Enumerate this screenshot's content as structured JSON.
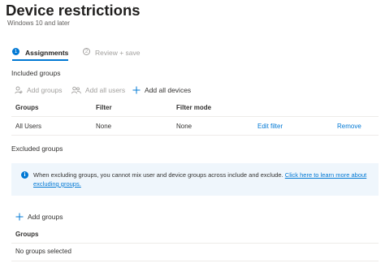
{
  "header": {
    "title": "Device restrictions",
    "more_label": "···",
    "subtitle": "Windows 10 and later"
  },
  "wizard": {
    "steps": [
      {
        "number": "1",
        "label": "Assignments"
      },
      {
        "number": "2",
        "label": "Review + save"
      }
    ]
  },
  "included": {
    "heading": "Included groups",
    "commands": {
      "add_groups": "Add groups",
      "add_all_users": "Add all users",
      "add_all_devices": "Add all devices"
    },
    "table": {
      "columns": [
        "Groups",
        "Filter",
        "Filter mode"
      ],
      "rows": [
        {
          "group": "All Users",
          "filter": "None",
          "filter_mode": "None",
          "edit": "Edit filter",
          "remove": "Remove"
        }
      ]
    }
  },
  "excluded": {
    "heading": "Excluded groups",
    "banner": {
      "icon": "info-icon",
      "text": "When excluding groups, you cannot mix user and device groups across include and exclude.",
      "link": "Click here to learn more about excluding groups."
    },
    "commands": {
      "add_groups": "Add groups"
    },
    "table": {
      "column": "Groups",
      "empty": "No groups selected"
    }
  },
  "colors": {
    "accent": "#0078d4",
    "banner_bg": "#eff6fc",
    "disabled": "#a19f9d"
  }
}
